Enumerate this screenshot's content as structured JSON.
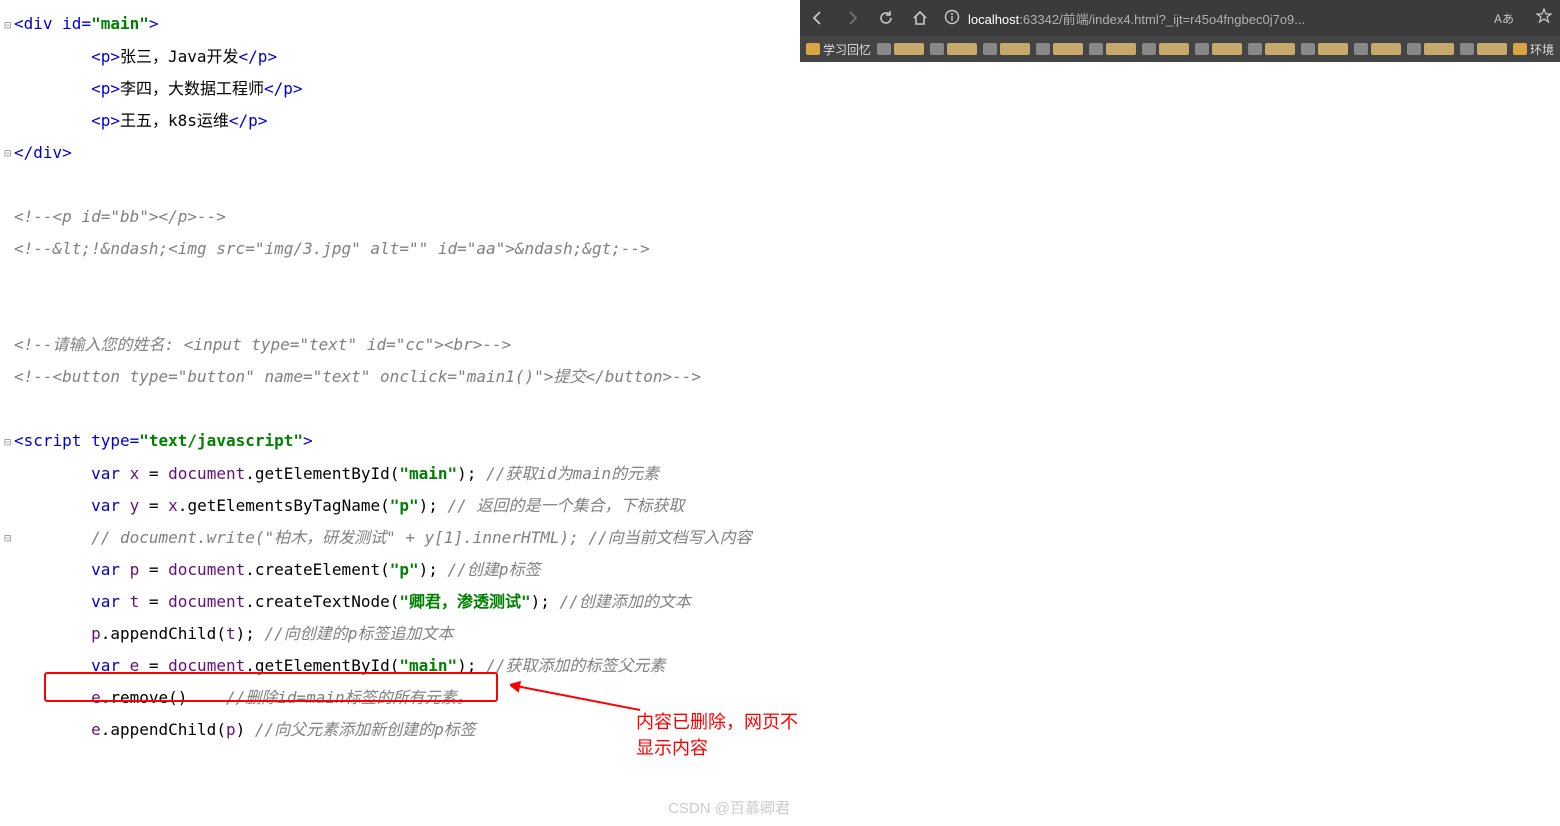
{
  "code": {
    "lines": [
      {
        "indent": 0,
        "gutter": "⊟",
        "segs": [
          {
            "c": "bracket",
            "t": "<"
          },
          {
            "c": "tag",
            "t": "div "
          },
          {
            "c": "attr-name",
            "t": "id"
          },
          {
            "c": "bracket",
            "t": "="
          },
          {
            "c": "attr-val",
            "t": "\"main\""
          },
          {
            "c": "bracket",
            "t": ">"
          }
        ]
      },
      {
        "indent": 2,
        "segs": [
          {
            "c": "bracket",
            "t": "<"
          },
          {
            "c": "tag",
            "t": "p"
          },
          {
            "c": "bracket",
            "t": ">"
          },
          {
            "c": "text-content",
            "t": "张三，Java开发"
          },
          {
            "c": "bracket",
            "t": "</"
          },
          {
            "c": "tag",
            "t": "p"
          },
          {
            "c": "bracket",
            "t": ">"
          }
        ]
      },
      {
        "indent": 2,
        "segs": [
          {
            "c": "bracket",
            "t": "<"
          },
          {
            "c": "tag",
            "t": "p"
          },
          {
            "c": "bracket",
            "t": ">"
          },
          {
            "c": "text-content",
            "t": "李四，大数据工程师"
          },
          {
            "c": "bracket",
            "t": "</"
          },
          {
            "c": "tag",
            "t": "p"
          },
          {
            "c": "bracket",
            "t": ">"
          }
        ]
      },
      {
        "indent": 2,
        "segs": [
          {
            "c": "bracket",
            "t": "<"
          },
          {
            "c": "tag",
            "t": "p"
          },
          {
            "c": "bracket",
            "t": ">"
          },
          {
            "c": "text-content",
            "t": "王五，k8s运维"
          },
          {
            "c": "bracket",
            "t": "</"
          },
          {
            "c": "tag",
            "t": "p"
          },
          {
            "c": "bracket",
            "t": ">"
          }
        ]
      },
      {
        "indent": 0,
        "gutter": "⊟",
        "segs": [
          {
            "c": "bracket",
            "t": "</"
          },
          {
            "c": "tag",
            "t": "div"
          },
          {
            "c": "bracket",
            "t": ">"
          }
        ]
      },
      {
        "indent": 0,
        "segs": []
      },
      {
        "indent": 0,
        "segs": [
          {
            "c": "comment",
            "t": "<!--<p id=\"bb\"></p>-->"
          }
        ]
      },
      {
        "indent": 0,
        "segs": [
          {
            "c": "comment",
            "t": "<!--&lt;!&ndash;<img src=\"img/3.jpg\" alt=\"\" id=\"aa\">&ndash;&gt;-->"
          }
        ]
      },
      {
        "indent": 0,
        "segs": []
      },
      {
        "indent": 0,
        "segs": []
      },
      {
        "indent": 0,
        "segs": [
          {
            "c": "comment",
            "t": "<!--请输入您的姓名: <input type=\"text\" id=\"cc\"><br>-->"
          }
        ]
      },
      {
        "indent": 0,
        "segs": [
          {
            "c": "comment",
            "t": "<!--<button type=\"button\" name=\"text\" onclick=\"main1()\">提交</button>-->"
          }
        ]
      },
      {
        "indent": 0,
        "segs": []
      },
      {
        "indent": 0,
        "gutter": "⊟",
        "segs": [
          {
            "c": "bracket",
            "t": "<"
          },
          {
            "c": "tag",
            "t": "script "
          },
          {
            "c": "attr-name",
            "t": "type"
          },
          {
            "c": "bracket",
            "t": "="
          },
          {
            "c": "attr-val",
            "t": "\"text/javascript\""
          },
          {
            "c": "bracket",
            "t": ">"
          }
        ]
      },
      {
        "indent": 2,
        "segs": [
          {
            "c": "kw",
            "t": "var"
          },
          {
            "c": "text-content",
            "t": " "
          },
          {
            "c": "ident",
            "t": "x"
          },
          {
            "c": "text-content",
            "t": " = "
          },
          {
            "c": "ident",
            "t": "document"
          },
          {
            "c": "text-content",
            "t": "."
          },
          {
            "c": "func",
            "t": "getElementById"
          },
          {
            "c": "text-content",
            "t": "("
          },
          {
            "c": "str",
            "t": "\"main\""
          },
          {
            "c": "text-content",
            "t": "); "
          },
          {
            "c": "comment",
            "t": "//获取id为main的元素"
          }
        ]
      },
      {
        "indent": 2,
        "segs": [
          {
            "c": "kw",
            "t": "var"
          },
          {
            "c": "text-content",
            "t": " "
          },
          {
            "c": "ident",
            "t": "y"
          },
          {
            "c": "text-content",
            "t": " = "
          },
          {
            "c": "ident",
            "t": "x"
          },
          {
            "c": "text-content",
            "t": "."
          },
          {
            "c": "func",
            "t": "getElementsByTagName"
          },
          {
            "c": "text-content",
            "t": "("
          },
          {
            "c": "str",
            "t": "\"p\""
          },
          {
            "c": "text-content",
            "t": "); "
          },
          {
            "c": "comment",
            "t": "// 返回的是一个集合，下标获取"
          }
        ]
      },
      {
        "indent": 2,
        "gutter": "⊟",
        "segs": [
          {
            "c": "comment",
            "t": "// document.write(\"柏木，研发测试\" + y[1].innerHTML); //向当前文档写入内容"
          }
        ]
      },
      {
        "indent": 2,
        "segs": [
          {
            "c": "kw",
            "t": "var"
          },
          {
            "c": "text-content",
            "t": " "
          },
          {
            "c": "ident",
            "t": "p"
          },
          {
            "c": "text-content",
            "t": " = "
          },
          {
            "c": "ident",
            "t": "document"
          },
          {
            "c": "text-content",
            "t": "."
          },
          {
            "c": "func",
            "t": "createElement"
          },
          {
            "c": "text-content",
            "t": "("
          },
          {
            "c": "str",
            "t": "\"p\""
          },
          {
            "c": "text-content",
            "t": "); "
          },
          {
            "c": "comment",
            "t": "//创建p标签"
          }
        ]
      },
      {
        "indent": 2,
        "segs": [
          {
            "c": "kw",
            "t": "var"
          },
          {
            "c": "text-content",
            "t": " "
          },
          {
            "c": "ident",
            "t": "t"
          },
          {
            "c": "text-content",
            "t": " = "
          },
          {
            "c": "ident",
            "t": "document"
          },
          {
            "c": "text-content",
            "t": "."
          },
          {
            "c": "func",
            "t": "createTextNode"
          },
          {
            "c": "text-content",
            "t": "("
          },
          {
            "c": "str",
            "t": "\"卿君，渗透测试\""
          },
          {
            "c": "text-content",
            "t": "); "
          },
          {
            "c": "comment",
            "t": "//创建添加的文本"
          }
        ]
      },
      {
        "indent": 2,
        "segs": [
          {
            "c": "ident",
            "t": "p"
          },
          {
            "c": "text-content",
            "t": "."
          },
          {
            "c": "func",
            "t": "appendChild"
          },
          {
            "c": "text-content",
            "t": "("
          },
          {
            "c": "ident",
            "t": "t"
          },
          {
            "c": "text-content",
            "t": "); "
          },
          {
            "c": "comment",
            "t": "//向创建的p标签追加文本"
          }
        ]
      },
      {
        "indent": 2,
        "segs": [
          {
            "c": "kw",
            "t": "var"
          },
          {
            "c": "text-content",
            "t": " "
          },
          {
            "c": "ident",
            "t": "e"
          },
          {
            "c": "text-content",
            "t": " = "
          },
          {
            "c": "ident",
            "t": "document"
          },
          {
            "c": "text-content",
            "t": "."
          },
          {
            "c": "func",
            "t": "getElementById"
          },
          {
            "c": "text-content",
            "t": "("
          },
          {
            "c": "str",
            "t": "\"main\""
          },
          {
            "c": "text-content",
            "t": "); "
          },
          {
            "c": "comment",
            "t": "//获取添加的标签父元素"
          }
        ]
      },
      {
        "indent": 2,
        "segs": [
          {
            "c": "ident",
            "t": "e"
          },
          {
            "c": "text-content",
            "t": "."
          },
          {
            "c": "func",
            "t": "remove"
          },
          {
            "c": "text-content",
            "t": "()    "
          },
          {
            "c": "comment",
            "t": "//删除id=main标签的所有元素。"
          }
        ]
      },
      {
        "indent": 2,
        "segs": [
          {
            "c": "ident",
            "t": "e"
          },
          {
            "c": "text-content",
            "t": "."
          },
          {
            "c": "func",
            "t": "appendChild"
          },
          {
            "c": "text-content",
            "t": "("
          },
          {
            "c": "ident",
            "t": "p"
          },
          {
            "c": "text-content",
            "t": ") "
          },
          {
            "c": "comment",
            "t": "//向父元素添加新创建的p标签"
          }
        ]
      }
    ]
  },
  "annotation": "内容已删除，网页不显示内容",
  "watermark": "CSDN @百慕卿君",
  "browser": {
    "url_host": "localhost",
    "url_rest": ":63342/前端/index4.html?_ijt=r45o4fngbec0j7o9...",
    "reader_indicator": "Aあ",
    "bookmarks": [
      {
        "label": "学习回忆"
      },
      {
        "label": ""
      },
      {
        "label": ""
      },
      {
        "label": ""
      },
      {
        "label": ""
      },
      {
        "label": ""
      },
      {
        "label": ""
      },
      {
        "label": ""
      },
      {
        "label": ""
      },
      {
        "label": ""
      },
      {
        "label": ""
      },
      {
        "label": ""
      },
      {
        "label": ""
      },
      {
        "label": "环境"
      }
    ]
  }
}
